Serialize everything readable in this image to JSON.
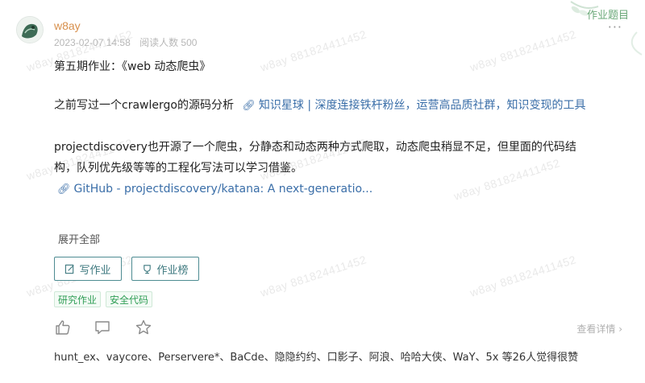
{
  "post": {
    "author": "w8ay",
    "date": "2023-02-07 14:58",
    "views": "阅读人数 500",
    "badge": "作业题目",
    "title": "第五期作业：《web 动态爬虫》",
    "para1_text": "之前写过一个crawlergo的源码分析",
    "para1_link": "知识星球 | 深度连接铁杆粉丝，运营高品质社群，知识变现的工具",
    "para2_line1": "projectdiscovery也开源了一个爬虫，分静态和动态两种方式爬取，动态爬虫稍显不足，但里面的代码结",
    "para2_line2": "构，队列优先级等等的工程化写法可以学习借鉴。",
    "github_link": "GitHub - projectdiscovery/katana: A next-generatio...",
    "expand": "展开全部",
    "watermark": "w8ay 881824411452"
  },
  "buttons": {
    "write": "写作业",
    "ranking": "作业榜"
  },
  "tags": [
    "研究作业",
    "安全代码"
  ],
  "actions": {
    "detail": "查看详情"
  },
  "likes": "hunt_ex、vaycore、Perservere*、BaCde、隐隐约约、口影子、阿浪、哈哈大侠、WaY、5x 等26人觉得很赞",
  "icons": {
    "avatar": "user-avatar",
    "link": "link-icon",
    "write": "edit-icon",
    "ranking": "trophy-icon",
    "like": "thumbs-up-icon",
    "comment": "comment-icon",
    "favorite": "star-icon",
    "more": "more-dots-icon",
    "chevron": "chevron-right-icon"
  },
  "colors": {
    "author": "#d78f4b",
    "link": "#3a6ea8",
    "button": "#4e8c92",
    "tag": "#2f9e55",
    "badge": "#6aa878"
  }
}
